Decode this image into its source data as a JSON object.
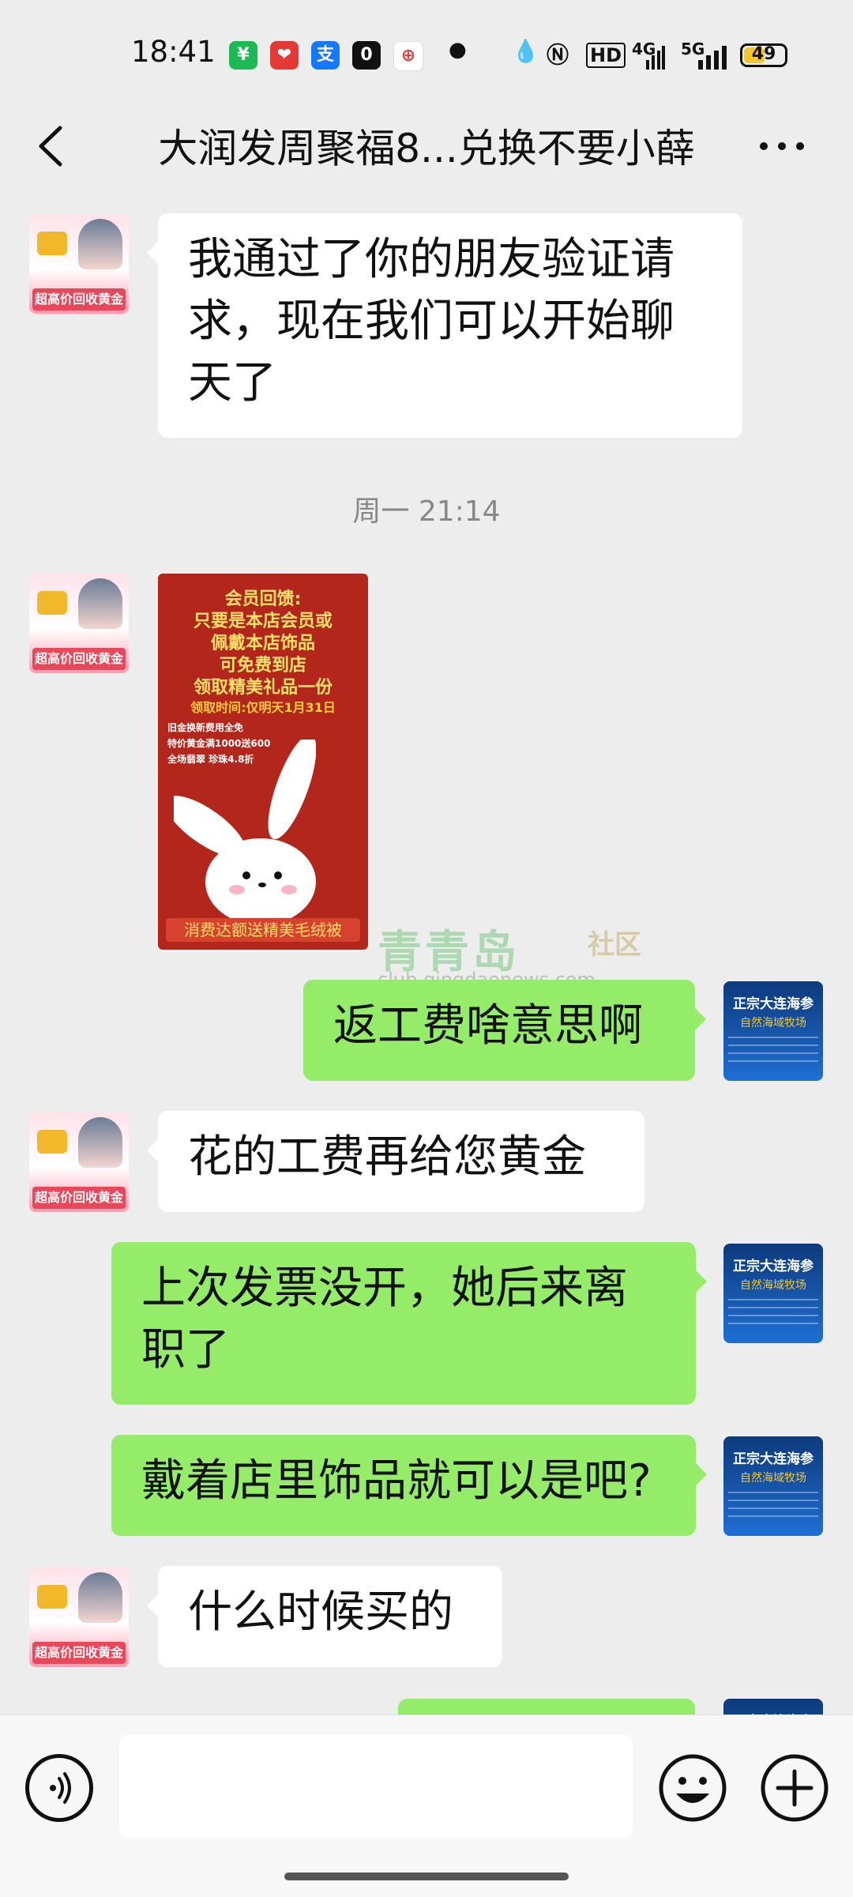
{
  "status_bar": {
    "time": "18:41",
    "network": "HD",
    "signal_labels": [
      "4G",
      "5G"
    ],
    "battery": "49",
    "app_icons": [
      {
        "icon": "wallet-app-icon",
        "color": "#1db954",
        "glyph": "¥"
      },
      {
        "icon": "heart-app-icon",
        "color": "#e53935",
        "glyph": "❤"
      },
      {
        "icon": "alipay-icon",
        "color": "#1677ff",
        "glyph": "支"
      },
      {
        "icon": "oppo-app-icon",
        "color": "#111111",
        "glyph": "0"
      },
      {
        "icon": "shield-app-icon",
        "color": "#ffffff",
        "glyph": "⊕"
      }
    ]
  },
  "header": {
    "title": "大润发周聚福8...兑换不要小薛"
  },
  "messages": [
    {
      "side": "left",
      "type": "text",
      "text": "我通过了你的朋友验证请求，现在我们可以开始聊天了"
    },
    {
      "type": "time",
      "text": "周一 21:14"
    },
    {
      "side": "left",
      "type": "image"
    },
    {
      "side": "right",
      "type": "text",
      "text": "返工费啥意思啊"
    },
    {
      "side": "left",
      "type": "text",
      "text": "花的工费再给您黄金"
    },
    {
      "side": "right",
      "type": "text",
      "text": "上次发票没开，她后来离职了"
    },
    {
      "side": "right",
      "type": "text",
      "text": "戴着店里饰品就可以是吧?"
    },
    {
      "side": "left",
      "type": "text",
      "text": "什么时候买的"
    }
  ],
  "avatars": {
    "left_caption": "超高价回收黄金",
    "right_line1": "正宗大连海参",
    "right_line2": "自然海域牧场"
  },
  "poster": {
    "lines": [
      "会员回馈:",
      "只要是本店会员或",
      "佩戴本店饰品",
      "可免费到店",
      "领取精美礼品一份",
      "领取时间:仅明天1月31日"
    ],
    "items": [
      "旧金换新费用全免",
      "特价黄金满1000送600",
      "全场翡翠 珍珠4.8折"
    ],
    "bottom": "消费达额送精美毛绒被"
  },
  "watermark": {
    "brand": "青青岛",
    "section": "社区",
    "url": "club.qingdaonews.com"
  },
  "colors": {
    "bubble_self": "#95ec69",
    "bubble_other": "#ffffff",
    "background": "#ededed"
  }
}
